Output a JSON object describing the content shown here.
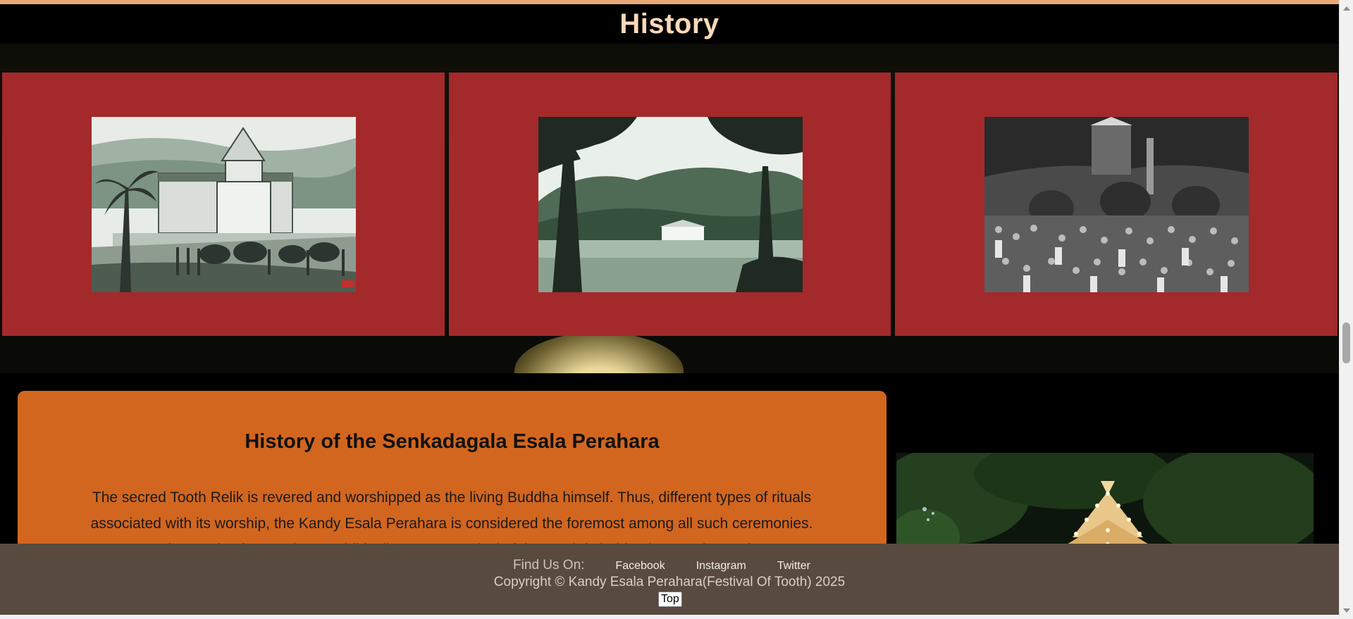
{
  "section": {
    "title": "History"
  },
  "gallery": {
    "images": [
      {
        "name": "temple-illustration",
        "alt": "Temple of the Tooth illustration with elephant procession"
      },
      {
        "name": "lake-view",
        "alt": "Temple by the lake framed by trees"
      },
      {
        "name": "perahara-crowd",
        "alt": "Historic perahara procession with elephants and crowd"
      }
    ]
  },
  "article": {
    "heading": "History of the Senkadagala Esala Perahara",
    "paragraph": "The secred Tooth Relik is revered and worshipped as the living Buddha himself. Thus, different types of rituals associated with its worship, the Kandy Esala Perahara is considered the foremost among all such ceremonies. In the words of an ancient Buddhist literature, Festival of the Tooth is held to honour the teeth"
  },
  "side_image": {
    "name": "illuminated-casket",
    "alt": "Illuminated relic casket at night"
  },
  "footer": {
    "find_us_label": "Find Us On:",
    "links": [
      "Facebook",
      "Instagram",
      "Twitter"
    ],
    "copyright": "Copyright © Kandy Esala Perahara(Festival Of Tooth) 2025",
    "top_button": "Top"
  },
  "colors": {
    "title": "#fcd9b8",
    "card_red": "#a4292b",
    "card_orange": "#d2661f",
    "footer_bg": "#594a3f"
  }
}
